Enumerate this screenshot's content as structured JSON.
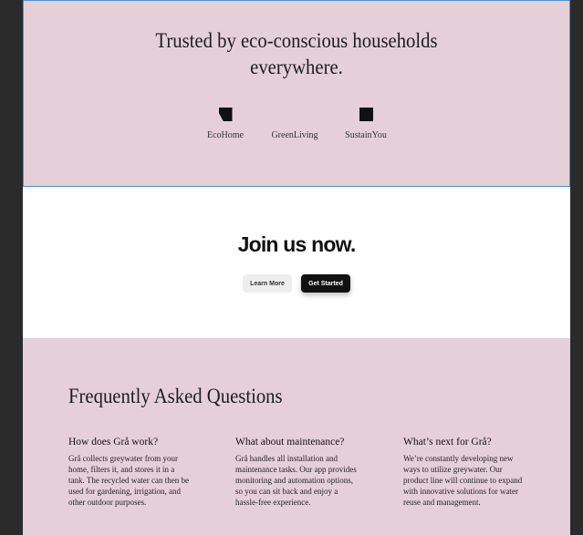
{
  "trusted": {
    "title_line1": "Trusted by eco-conscious households",
    "title_line2": "everywhere.",
    "logos": [
      {
        "name": "EcoHome",
        "icon": "eco-home-logo-icon"
      },
      {
        "name": "GreenLiving",
        "icon": "none"
      },
      {
        "name": "SustainYou",
        "icon": "sustain-you-logo-icon"
      }
    ]
  },
  "join": {
    "title": "Join us now.",
    "learn_more": "Learn More",
    "get_started": "Get Started"
  },
  "faq": {
    "title": "Frequently Asked Questions",
    "items": [
      {
        "question": "How does Grå work?",
        "answer": "Grå collects greywater from your home, filters it, and stores it in a tank. The recycled water can then be used for gardening, irrigation, and other outdoor purposes."
      },
      {
        "question": "What about maintenance?",
        "answer": "Grå handles all installation and maintenance tasks. Our app provides monitoring and automation options, so you can sit back and enjoy a hassle-free experience."
      },
      {
        "question": "What’s next for Grå?",
        "answer": "We’re constantly developing new ways to utilize greywater. Our product line will continue to expand with innovative solutions for water reuse and management."
      }
    ]
  },
  "colors": {
    "pink_bg": "#e5d0da",
    "selection_outline": "#4a90d9",
    "dark_button": "#111111",
    "light_button": "#eeeeee",
    "outer_bg": "#2b2b2b"
  }
}
